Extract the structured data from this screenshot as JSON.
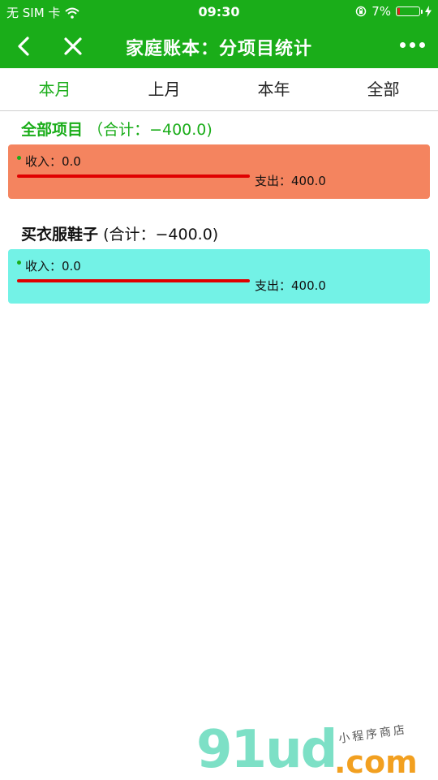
{
  "status": {
    "carrier": "无 SIM 卡",
    "time": "09:30",
    "battery": "7%"
  },
  "nav": {
    "title": "家庭账本：分项目统计"
  },
  "tabs": [
    {
      "label": "本月",
      "active": true
    },
    {
      "label": "上月",
      "active": false
    },
    {
      "label": "本年",
      "active": false
    },
    {
      "label": "全部",
      "active": false
    }
  ],
  "groups": [
    {
      "name": "全部项目",
      "total": "（合计：−400.0)",
      "color": "#f4845f",
      "income": "收入：0.0",
      "expense": "支出：400.0",
      "expense_share": 1.0
    },
    {
      "name": "买衣服鞋子",
      "total": "(合计：−400.0)",
      "color": "#73f2e6",
      "income": "收入：0.0",
      "expense": "支出：400.0",
      "expense_share": 1.0
    }
  ],
  "watermark": {
    "logo": "91ud",
    "domain": ".com",
    "tagline": "小程序商店"
  },
  "colors": {
    "brand_green": "#1aad19",
    "expense_bar": "#e00000"
  }
}
